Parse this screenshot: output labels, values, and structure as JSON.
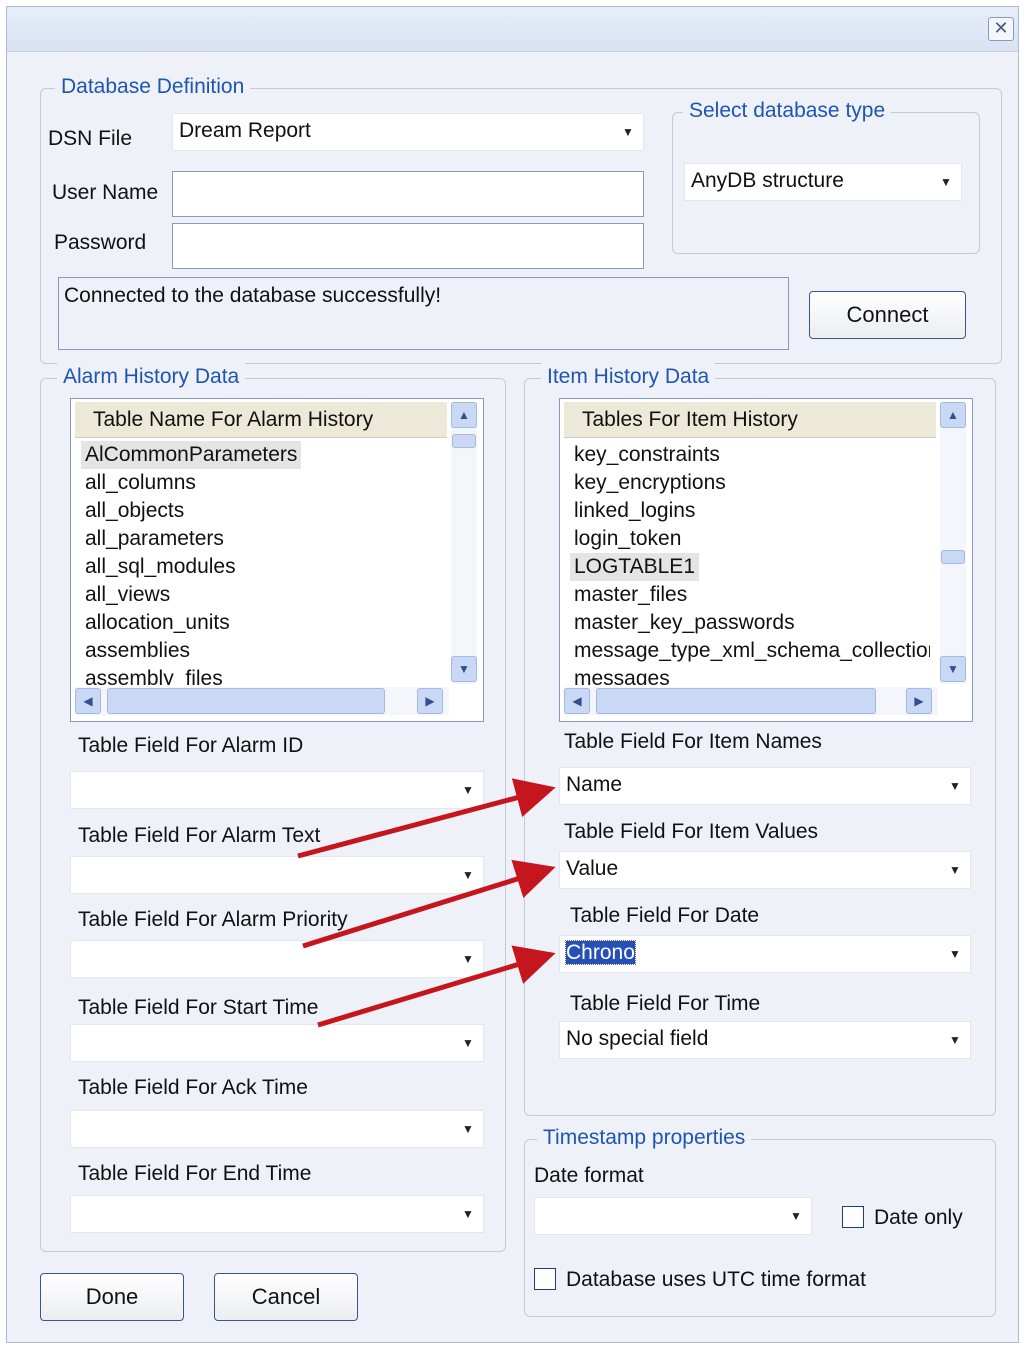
{
  "window": {
    "close_glyph": "✕"
  },
  "db_definition": {
    "title": "Database Definition",
    "dsn_label": "DSN File",
    "dsn_value": "Dream Report",
    "user_label": "User Name",
    "user_value": "",
    "password_label": "Password",
    "password_value": "",
    "status": "Connected to the database successfully!",
    "connect_label": "Connect"
  },
  "db_type": {
    "title": "Select database type",
    "value": "AnyDB structure"
  },
  "alarm": {
    "title": "Alarm History Data",
    "list_header": "Table Name For Alarm History",
    "items": [
      "AlCommonParameters",
      "all_columns",
      "all_objects",
      "all_parameters",
      "all_sql_modules",
      "all_views",
      "allocation_units",
      "assemblies",
      "assembly_files"
    ],
    "fields": [
      {
        "label": "Table Field For Alarm ID",
        "value": ""
      },
      {
        "label": "Table Field For Alarm Text",
        "value": ""
      },
      {
        "label": "Table Field For Alarm Priority",
        "value": ""
      },
      {
        "label": "Table Field For Start Time",
        "value": ""
      },
      {
        "label": "Table Field For Ack Time",
        "value": ""
      },
      {
        "label": "Table Field For End Time",
        "value": ""
      }
    ]
  },
  "item": {
    "title": "Item History Data",
    "list_header": "Tables For Item History",
    "items": [
      "key_constraints",
      "key_encryptions",
      "linked_logins",
      "login_token",
      "LOGTABLE1",
      "master_files",
      "master_key_passwords",
      "message_type_xml_schema_collection_usages",
      "messages"
    ],
    "fields": [
      {
        "label": "Table Field For Item Names",
        "value": "Name"
      },
      {
        "label": "Table Field For Item Values",
        "value": "Value"
      },
      {
        "label": "Table Field For Date",
        "value": "Chrono"
      },
      {
        "label": "Table Field For Time",
        "value": "No special field"
      }
    ]
  },
  "timestamp": {
    "title": "Timestamp properties",
    "date_format_label": "Date format",
    "date_format_value": "",
    "date_only_label": "Date only",
    "utc_label": "Database uses UTC time format"
  },
  "buttons": {
    "done": "Done",
    "cancel": "Cancel"
  },
  "colors": {
    "accent": "#1e55b3",
    "annotation_arrow": "#c4161c",
    "selection": "#2450b8"
  }
}
